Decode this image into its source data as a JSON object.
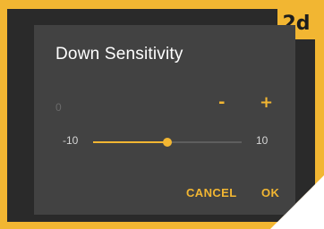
{
  "badge": "2d",
  "dialog": {
    "title": "Down Sensitivity",
    "current_value": "0",
    "minus_label": "-",
    "plus_label": "+",
    "slider": {
      "min_label": "-10",
      "max_label": "10",
      "min": -10,
      "max": 10,
      "value": 0
    },
    "cancel_label": "CANCEL",
    "ok_label": "OK"
  },
  "colors": {
    "accent": "#f2b632",
    "dialog_bg": "#424242",
    "frame_bg": "#2a2a2a"
  }
}
